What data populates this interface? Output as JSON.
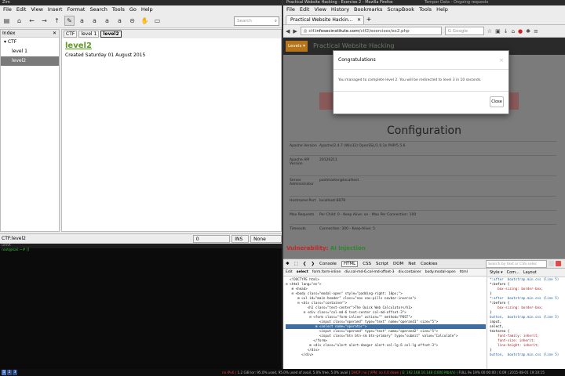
{
  "zim": {
    "title": "Zim",
    "menu": [
      "File",
      "Edit",
      "View",
      "Insert",
      "Format",
      "Search",
      "Tools",
      "Go",
      "Help"
    ],
    "search_placeholder": "Search",
    "index_label": "Index",
    "tree": [
      {
        "label": "CTF",
        "expander": "▾"
      },
      {
        "label": "level 1"
      },
      {
        "label": "level2"
      }
    ],
    "path": [
      "CTF",
      "level 1",
      "level2"
    ],
    "page_heading": "level2",
    "page_created": "Created Saturday 01 August 2015",
    "status": {
      "page": "CTF:level2",
      "backlinks": "0 Backlinks...",
      "mode": "INS",
      "style": "None"
    }
  },
  "terminal": {
    "title": "urxvt",
    "prompt": "root@kali:~# []"
  },
  "firefox": {
    "title": "Practical Website Hacking - Exercise 2 - Mozilla Firefox",
    "title_right": "Temper Data - Ongoing requests",
    "menu": [
      "File",
      "Edit",
      "View",
      "History",
      "Bookmarks",
      "ScrapBook",
      "Tools",
      "Help"
    ],
    "tab_label": "Practical Website Hackin...",
    "url_prefix": "ctf.",
    "url_domain": "infosecinstitute.com",
    "url_path": "/ctf2/exercises/ex2.php",
    "search_engine": "Google",
    "site": {
      "levels_button": "Levels ▾",
      "brand": "Practical Website Hacking",
      "config_heading": "Configuration",
      "rows": [
        {
          "k": "Apache Version",
          "v": "Apache/2.4.7 (Win32) OpenSSL/1.0.1e PHP/5.5.6"
        },
        {
          "k": "Apache API Version",
          "v": "20120211"
        },
        {
          "k": "Server Administrator",
          "v": "postmaster@localhost"
        },
        {
          "k": "Hostname:Port",
          "v": "localhost:8079"
        },
        {
          "k": "Max Requests",
          "v": "Per Child: 0 - Keep Alive: on - Max Per Connection: 100"
        },
        {
          "k": "Timeouts",
          "v": "Connection: 300 - Keep-Alive: 5"
        }
      ]
    },
    "modal": {
      "title": "Congratulations",
      "body": "You managed to complete level 2. You will be redirected to level 3 in 10 seconds.",
      "close_label": "Close"
    },
    "watermark_a": "Vulnerability: ",
    "watermark_b": "AI Injection",
    "devtools": {
      "tabs": [
        "Console",
        "HTML",
        "CSS",
        "Script",
        "DOM",
        "Net",
        "Cookies"
      ],
      "active_tab": "HTML",
      "search_placeholder": "Search by text or CSS selec",
      "edit_label": "Edit",
      "crumbs": [
        "select",
        "form.form-inline",
        "div.col-md-6.col-md-offset-3",
        "div.container",
        "body.modal-open",
        "html"
      ],
      "html_lines": [
        "  <!DOCTYPE html>",
        "⊟ <html lang=\"en\">",
        "   ⊞ <head>",
        "   ⊟ <body class=\"modal-open\" style=\"padding-right: 10px;\">",
        "      ⊞ <ul id=\"main-header\" class=\"nav nav-pills navbar-inverse\">",
        "      ⊟ <div class=\"container\">",
        "           <h1 class=\"text-center\">The Quick Web Calculator</h1>",
        "         ⊟ <div class=\"col-md-6 text-center col-md-offset-3\">",
        "            ⊟ <form class=\"form-inline\" action=\"\" method=\"POST\">",
        "                 <input class=\"operand\" type=\"text\" name=\"operand1\" size=\"5\">",
        "               ⊞ <select name=\"operator\">",
        "                 <input class=\"operand\" type=\"text\" name=\"operand2\" size=\"5\">",
        "                 <input class=\"btn btn-sm btn-primary\" type=\"submit\" value=\"Calculate\">",
        "              </form>",
        "            ⊞ <div class=\"alert alert-danger alert-col-lg-6 col-lg-offset-3\">",
        "           </div>",
        "        </div>"
      ],
      "selected_line": 10,
      "css_tabs": [
        "Style ▾",
        "Com...",
        "Layout"
      ],
      "css_lines": [
        {
          "t": "*:after  bootstrap.min.css (line 5)",
          "c": "sel"
        },
        {
          "t": "*:before {",
          "c": ""
        },
        {
          "t": "    box-sizing: border-box;",
          "c": "prop"
        },
        {
          "t": "}",
          "c": ""
        },
        {
          "t": "*:after  bootstrap.min.css (line 5)",
          "c": "sel"
        },
        {
          "t": "*:before {",
          "c": ""
        },
        {
          "t": "    box-sizing: border-box;",
          "c": "prop"
        },
        {
          "t": "}",
          "c": ""
        },
        {
          "t": "button,  bootstrap.min.css (line 5)",
          "c": "sel"
        },
        {
          "t": "input,",
          "c": ""
        },
        {
          "t": "select,",
          "c": ""
        },
        {
          "t": "textarea {",
          "c": ""
        },
        {
          "t": "    font-family: inherit;",
          "c": "prop"
        },
        {
          "t": "    font-size: inherit;",
          "c": "prop"
        },
        {
          "t": "    line-height: inherit;",
          "c": "prop"
        },
        {
          "t": "}",
          "c": ""
        },
        {
          "t": "button,  bootstrap.min.css (line 5)",
          "c": "sel"
        }
      ]
    }
  },
  "taskbar": {
    "workspaces": [
      "1",
      "2",
      "3"
    ],
    "status_a": "no IPv6 | ",
    "status_b": "1.2 GiB lor: 95.0% used, 95.0% used of avail, 5.0% free, 5.0% avail | ",
    "status_c": "DHCP: no | VPN: no 4.0 down | ",
    "status_d": "E: 192.168.10.148 (1000 Mbit/s) | ",
    "status_e": "FULL 9x 19% 00:00:00 | 0.09 | 2015-08-01 19:10:15"
  }
}
